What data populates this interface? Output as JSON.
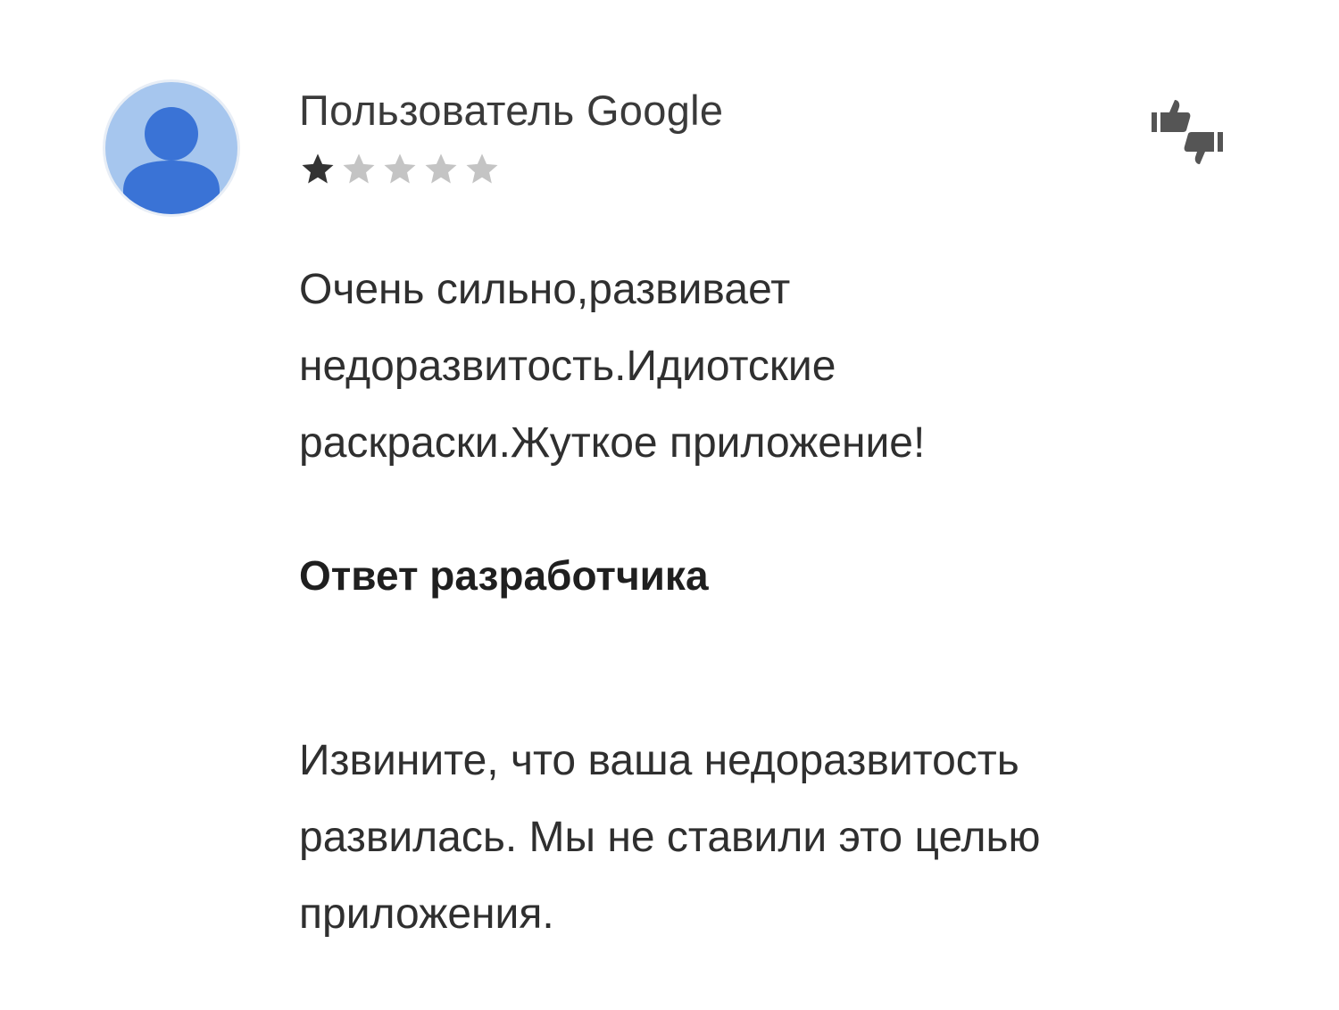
{
  "review": {
    "author": "Пользователь Google",
    "rating": 1,
    "max_rating": 5,
    "text_lines": [
      "Очень сильно,развивает",
      "недоразвитость.Идиотские",
      "раскраски.Жуткое приложение!"
    ],
    "icons": {
      "avatar": "default-user-avatar-icon",
      "rating_actions": "thumbs-up-down-icon"
    }
  },
  "developer_response": {
    "heading": "Ответ разработчика",
    "text_lines": [
      "Извините, что ваша недоразвитость",
      "развилась. Мы не ставили это целью",
      "приложения."
    ]
  },
  "colors": {
    "avatar_bg": "#a6c6ee",
    "avatar_figure": "#3a73d6",
    "star_filled": "#333333",
    "star_empty": "#c4c4c4"
  }
}
